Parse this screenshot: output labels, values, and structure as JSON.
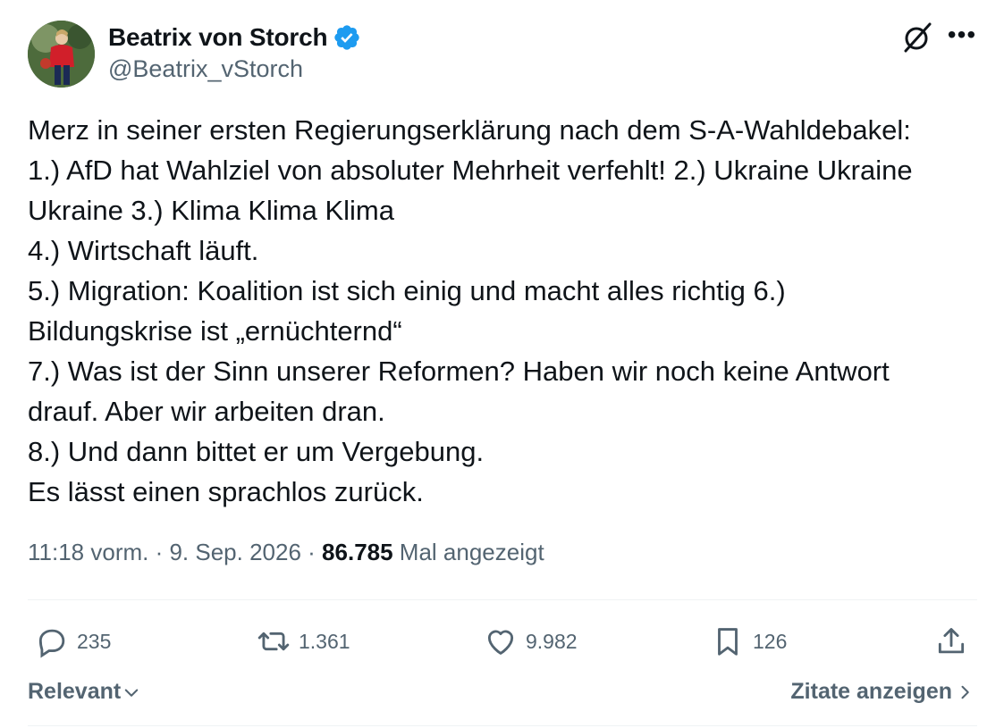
{
  "author": {
    "display_name": "Beatrix von Storch",
    "handle": "@Beatrix_vStorch",
    "verified": true,
    "verified_color": "#1d9bf0"
  },
  "tweet": {
    "lines": [
      "Merz in seiner ersten Regierungserklärung nach dem S-A-Wahldebakel:",
      "1.) AfD hat Wahlziel von absoluter Mehrheit verfehlt! 2.) Ukraine Ukraine",
      "Ukraine 3.) Klima Klima Klima",
      "4.) Wirtschaft läuft.",
      "5.) Migration: Koalition ist sich einig und macht alles richtig 6.)",
      "Bildungskrise ist „ernüchternd“",
      "7.) Was ist der Sinn unserer Reformen? Haben wir noch keine Antwort",
      "drauf. Aber wir arbeiten dran.",
      "8.) Und dann bittet er um Vergebung.",
      "Es lässt einen sprachlos zurück."
    ]
  },
  "meta": {
    "time": "11:18 vorm.",
    "sep1": " · ",
    "date": "9. Sep. 2026",
    "sep2": " · ",
    "views_count": "86.785",
    "views_label": " Mal angezeigt"
  },
  "actions": {
    "replies": "235",
    "reposts": "1.361",
    "likes": "9.982",
    "bookmarks": "126"
  },
  "footer": {
    "sort_label": "Relevant",
    "quotes_label": "Zitate anzeigen"
  },
  "icons": {
    "grok": "grok-icon",
    "more": "more-icon",
    "reply": "reply-icon",
    "repost": "repost-icon",
    "like": "heart-icon",
    "bookmark": "bookmark-icon",
    "share": "share-icon"
  },
  "colors": {
    "text": "#0f1419",
    "secondary": "#536471",
    "divider": "#eff3f4"
  }
}
